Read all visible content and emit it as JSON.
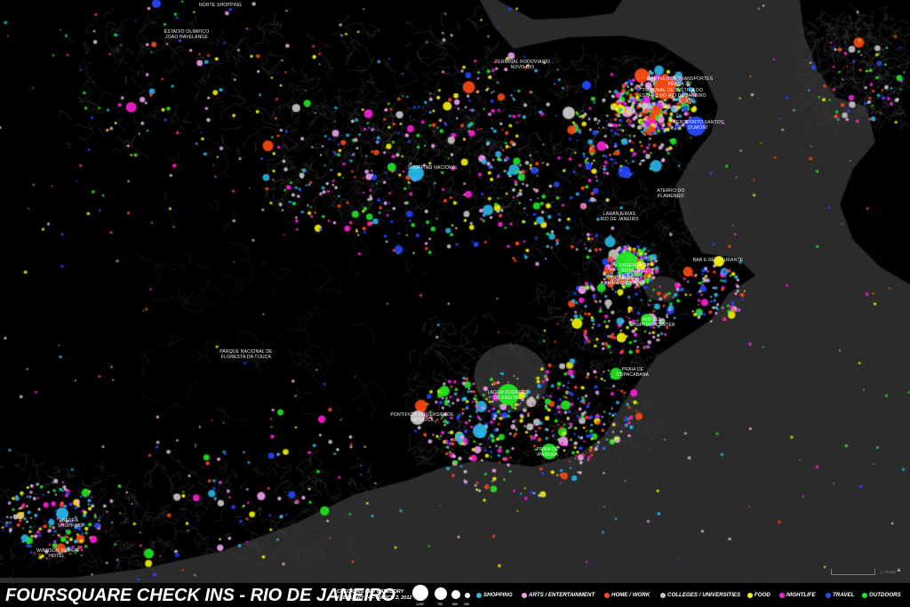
{
  "title": "FOURSQUARE CHECK INS - RIO DE JANEIRO",
  "subtitle_lines": [
    "CHECK INS PER CATEGORY",
    "FEBRUARY 24 – MARCH 2, 2012"
  ],
  "size_legend": [
    "1,000",
    "750",
    "500",
    "250"
  ],
  "categories": [
    {
      "key": "shopping",
      "label": "SHOPPING",
      "color": "#29b6e8"
    },
    {
      "key": "arts",
      "label": "ARTS / ENTERTAINMENT",
      "color": "#f0a0f0"
    },
    {
      "key": "home",
      "label": "HOME / WORK",
      "color": "#ff4a12"
    },
    {
      "key": "colleges",
      "label": "COLLEGES / UNIVERSITIES",
      "color": "#c8c8c8"
    },
    {
      "key": "food",
      "label": "FOOD",
      "color": "#f5f500"
    },
    {
      "key": "nightlife",
      "label": "NIGHTLIFE",
      "color": "#ff1ed8"
    },
    {
      "key": "travel",
      "label": "TRAVEL",
      "color": "#2646ff"
    },
    {
      "key": "outdoors",
      "label": "OUTDOORS",
      "color": "#22e822"
    }
  ],
  "map_colors": {
    "land": "#000000",
    "water": "#2b2b2b",
    "roads": "#3c3c3c"
  },
  "place_labels": [
    "NORTE SHOPPING",
    "ESTADIO OLIMPICO\nJOAO HAVELANGE",
    "TERMINAL RODOVIARIO\nNOVO RIO",
    "MARINA DOS TRANSPORTES\nPRAÇA XV",
    "TRIBUNAL DE JUSTICA DO\nESTADO DO RIO DE JANEIRO",
    "AEROPORTO SANTOS\nDUMONT",
    "SHOPPING NACIONAL",
    "ATERRO DO\nFLAMENGO",
    "LARANJEIRAS\nRIO DE JANEIRO",
    "BAR E RESTAURANTE",
    "ENSEADA DE\nBOTAFOGO",
    "BOTAFOGO\nPRAIA SHOPPING",
    "RIO SUL\nSHOPPING CENTER",
    "PARQUE NACIONAL DE\nFLORESTA DA TIJUCA",
    "PRAIA DE\nCOPACABANA",
    "LAGOA RODRIGO\nDE FREITAS",
    "PONTIFICIA UNIVERSIDADE\nCATOLICA",
    "PRAIA DE\nIPANEMA",
    "BARRA\nSHOPPING",
    "WINDSOR BARRA\nHOTEL"
  ],
  "scale_label": "1 : 20,000"
}
